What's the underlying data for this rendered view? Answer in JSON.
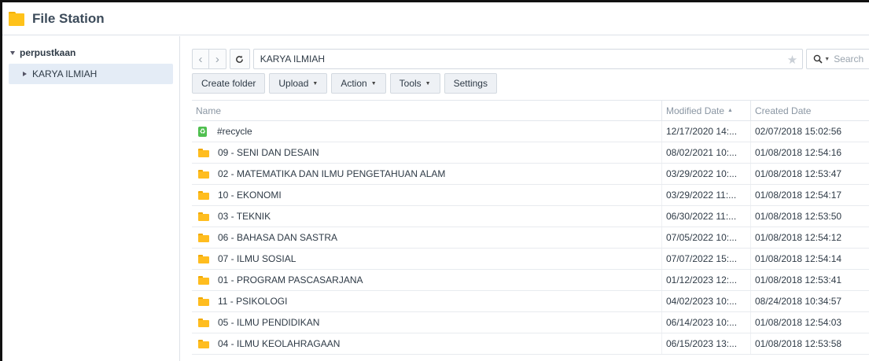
{
  "app": {
    "title": "File Station",
    "colors": {
      "accent": "#ffc21a",
      "selection": "#e4ecf6",
      "recycle": "#4fbf4f"
    }
  },
  "sidebar": {
    "root_label": "perpustkaan",
    "items": [
      {
        "label": "KARYA ILMIAH",
        "selected": true
      }
    ]
  },
  "pathbar": {
    "path": "KARYA ILMIAH",
    "search_placeholder": "Search",
    "icons": [
      "chevron-left-icon",
      "chevron-right-icon",
      "refresh-icon",
      "star-icon",
      "search-icon"
    ]
  },
  "toolbar": {
    "create_folder": "Create folder",
    "upload": "Upload",
    "action": "Action",
    "tools": "Tools",
    "settings": "Settings"
  },
  "grid": {
    "columns": {
      "name": "Name",
      "modified": "Modified Date",
      "created": "Created Date"
    },
    "sort": {
      "column": "modified",
      "direction": "ascending"
    },
    "rows": [
      {
        "icon": "recycle-icon",
        "name": "#recycle",
        "modified": "12/17/2020 14:...",
        "created": "02/07/2018 15:02:56"
      },
      {
        "icon": "folder-icon",
        "name": "09 - SENI DAN DESAIN",
        "modified": "08/02/2021 10:...",
        "created": "01/08/2018 12:54:16"
      },
      {
        "icon": "folder-icon",
        "name": "02 - MATEMATIKA DAN ILMU PENGETAHUAN ALAM",
        "modified": "03/29/2022 10:...",
        "created": "01/08/2018 12:53:47"
      },
      {
        "icon": "folder-icon",
        "name": "10 - EKONOMI",
        "modified": "03/29/2022 11:...",
        "created": "01/08/2018 12:54:17"
      },
      {
        "icon": "folder-icon",
        "name": "03 - TEKNIK",
        "modified": "06/30/2022 11:...",
        "created": "01/08/2018 12:53:50"
      },
      {
        "icon": "folder-icon",
        "name": "06 - BAHASA DAN SASTRA",
        "modified": "07/05/2022 10:...",
        "created": "01/08/2018 12:54:12"
      },
      {
        "icon": "folder-icon",
        "name": "07 - ILMU SOSIAL",
        "modified": "07/07/2022 15:...",
        "created": "01/08/2018 12:54:14"
      },
      {
        "icon": "folder-icon",
        "name": "01 - PROGRAM PASCASARJANA",
        "modified": "01/12/2023 12:...",
        "created": "01/08/2018 12:53:41"
      },
      {
        "icon": "folder-icon",
        "name": "11 - PSIKOLOGI",
        "modified": "04/02/2023 10:...",
        "created": "08/24/2018 10:34:57"
      },
      {
        "icon": "folder-icon",
        "name": "05 - ILMU PENDIDIKAN",
        "modified": "06/14/2023 10:...",
        "created": "01/08/2018 12:54:03"
      },
      {
        "icon": "folder-icon",
        "name": "04 - ILMU KEOLAHRAGAAN",
        "modified": "06/15/2023 13:...",
        "created": "01/08/2018 12:53:58"
      }
    ]
  }
}
